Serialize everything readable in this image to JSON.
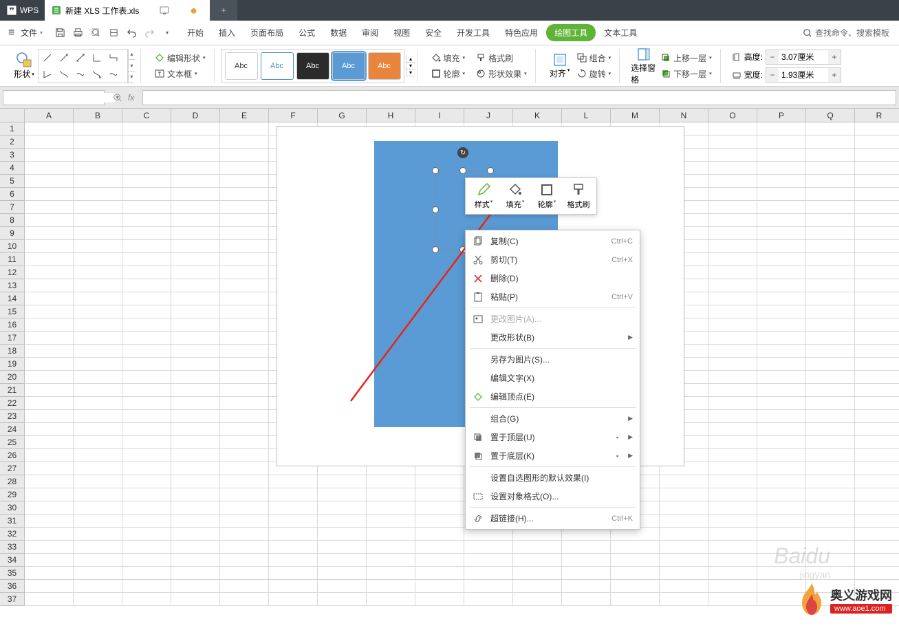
{
  "app": {
    "name": "WPS"
  },
  "doc": {
    "title": "新建 XLS 工作表.xls"
  },
  "menubar": {
    "file": "文件",
    "tabs": [
      "开始",
      "插入",
      "页面布局",
      "公式",
      "数据",
      "审阅",
      "视图",
      "安全",
      "开发工具",
      "特色应用",
      "绘图工具",
      "文本工具"
    ],
    "active": "绘图工具",
    "search_placeholder": "查找命令、搜索模板"
  },
  "ribbon": {
    "shape_label": "形状",
    "edit_shape": "编辑形状",
    "text_box": "文本框",
    "style_sample": "Abc",
    "fill": "填充",
    "format_painter": "格式刷",
    "outline": "轮廓",
    "shape_effect": "形状效果",
    "align": "对齐",
    "group": "组合",
    "rotate": "旋转",
    "select_pane": "选择窗格",
    "bring_fwd": "上移一层",
    "send_back": "下移一层",
    "height_label": "高度:",
    "height_value": "3.07厘米",
    "width_label": "宽度:",
    "width_value": "1.93厘米"
  },
  "mini_toolbar": {
    "style": "样式",
    "fill": "填充",
    "outline": "轮廓",
    "format_painter": "格式刷"
  },
  "context_menu": {
    "copy": "复制(C)",
    "copy_sc": "Ctrl+C",
    "cut": "剪切(T)",
    "cut_sc": "Ctrl+X",
    "delete": "删除(D)",
    "paste": "粘贴(P)",
    "paste_sc": "Ctrl+V",
    "change_pic": "更改图片(A)...",
    "change_shape": "更改形状(B)",
    "save_pic": "另存为图片(S)...",
    "edit_text": "编辑文字(X)",
    "edit_points": "编辑顶点(E)",
    "group": "组合(G)",
    "bring_top": "置于顶层(U)",
    "send_bottom": "置于底层(K)",
    "default_effect": "设置自选图形的默认效果(I)",
    "format_object": "设置对象格式(O)...",
    "hyperlink": "超链接(H)...",
    "hyperlink_sc": "Ctrl+K"
  },
  "columns": [
    "A",
    "B",
    "C",
    "D",
    "E",
    "F",
    "G",
    "H",
    "I",
    "J",
    "K",
    "L",
    "M",
    "N",
    "O",
    "P",
    "Q",
    "R"
  ],
  "rows": [
    1,
    2,
    3,
    4,
    5,
    6,
    7,
    8,
    9,
    10,
    11,
    12,
    13,
    14,
    15,
    16,
    17,
    18,
    19,
    20,
    21,
    22,
    23,
    24,
    25,
    26,
    27,
    28,
    29,
    30,
    31,
    32,
    33,
    34,
    35,
    36,
    37
  ],
  "watermark": {
    "main": "Baidu",
    "sub": "jingyan"
  },
  "site": {
    "name": "奥义游戏网",
    "url": "www.aoe1.com"
  }
}
